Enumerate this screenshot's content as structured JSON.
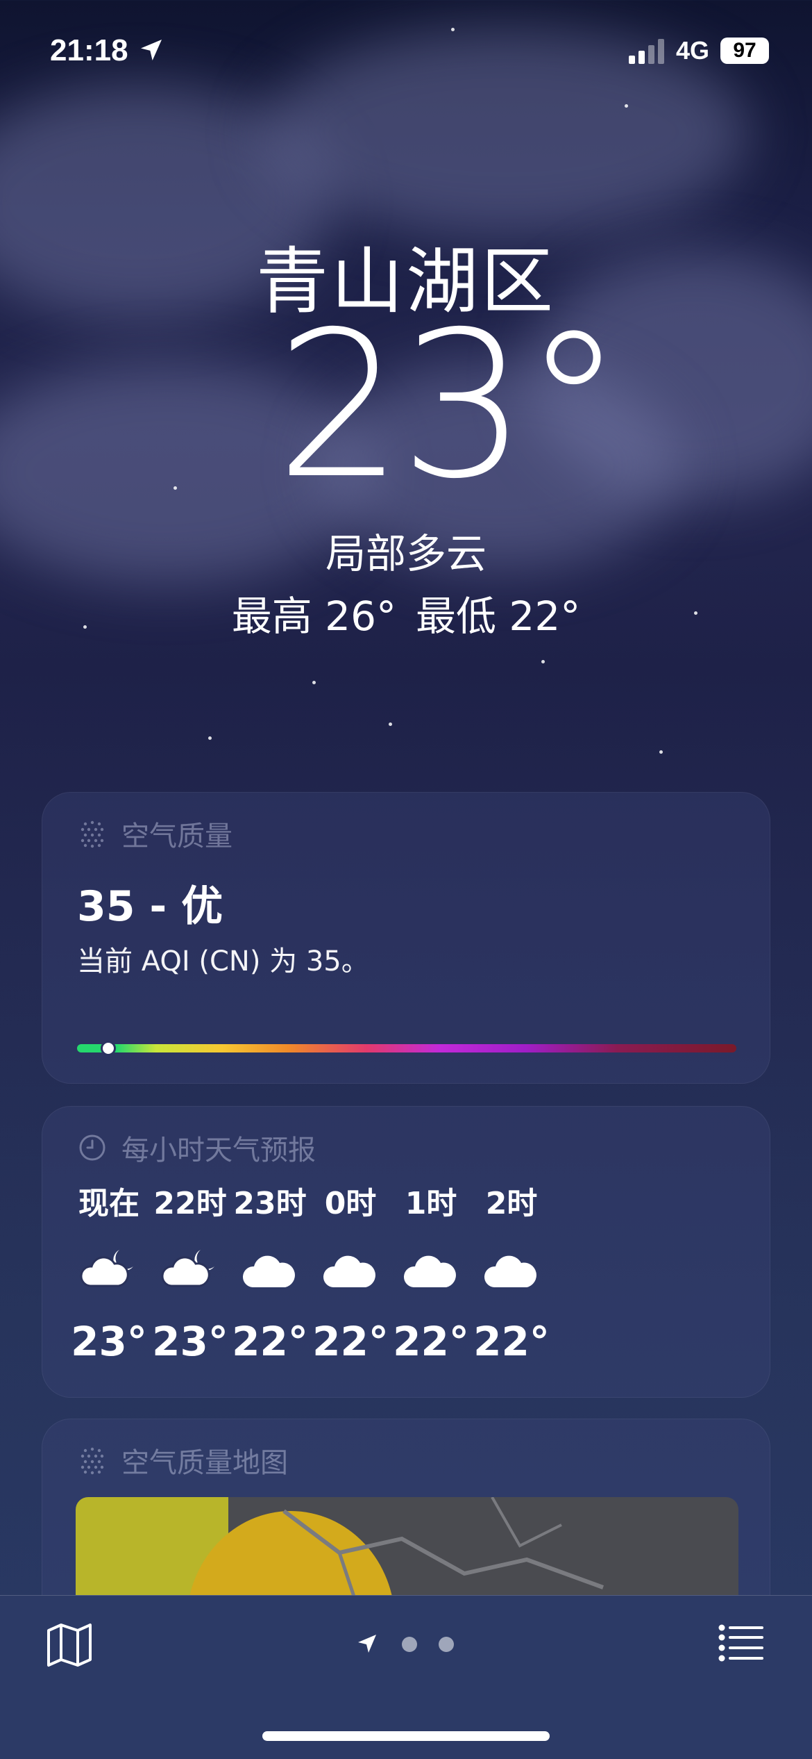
{
  "status": {
    "time": "21:18",
    "network": "4G",
    "battery": "97"
  },
  "weather": {
    "city": "青山湖区",
    "temperature": "23°",
    "condition": "局部多云",
    "high": "最高 26°",
    "low": "最低 22°"
  },
  "aqi": {
    "title": "空气质量",
    "value_label": "35 - 优",
    "description": "当前 AQI (CN) 为 35。",
    "position": 0.047
  },
  "hourly": {
    "title": "每小时天气预报",
    "items": [
      {
        "hour": "现在",
        "icon": "partly-cloudy-night-icon",
        "temp": "23°"
      },
      {
        "hour": "22时",
        "icon": "partly-cloudy-night-icon",
        "temp": "23°"
      },
      {
        "hour": "23时",
        "icon": "cloud-icon",
        "temp": "22°"
      },
      {
        "hour": "0时",
        "icon": "cloud-icon",
        "temp": "22°"
      },
      {
        "hour": "1时",
        "icon": "cloud-icon",
        "temp": "22°"
      },
      {
        "hour": "2时",
        "icon": "cloud-icon",
        "temp": "22°"
      }
    ]
  },
  "map": {
    "title": "空气质量地图"
  },
  "tabbar": {
    "icons": [
      "map-icon",
      "location-arrow-icon",
      "page-dot-icon",
      "page-dot-icon",
      "list-icon"
    ]
  }
}
